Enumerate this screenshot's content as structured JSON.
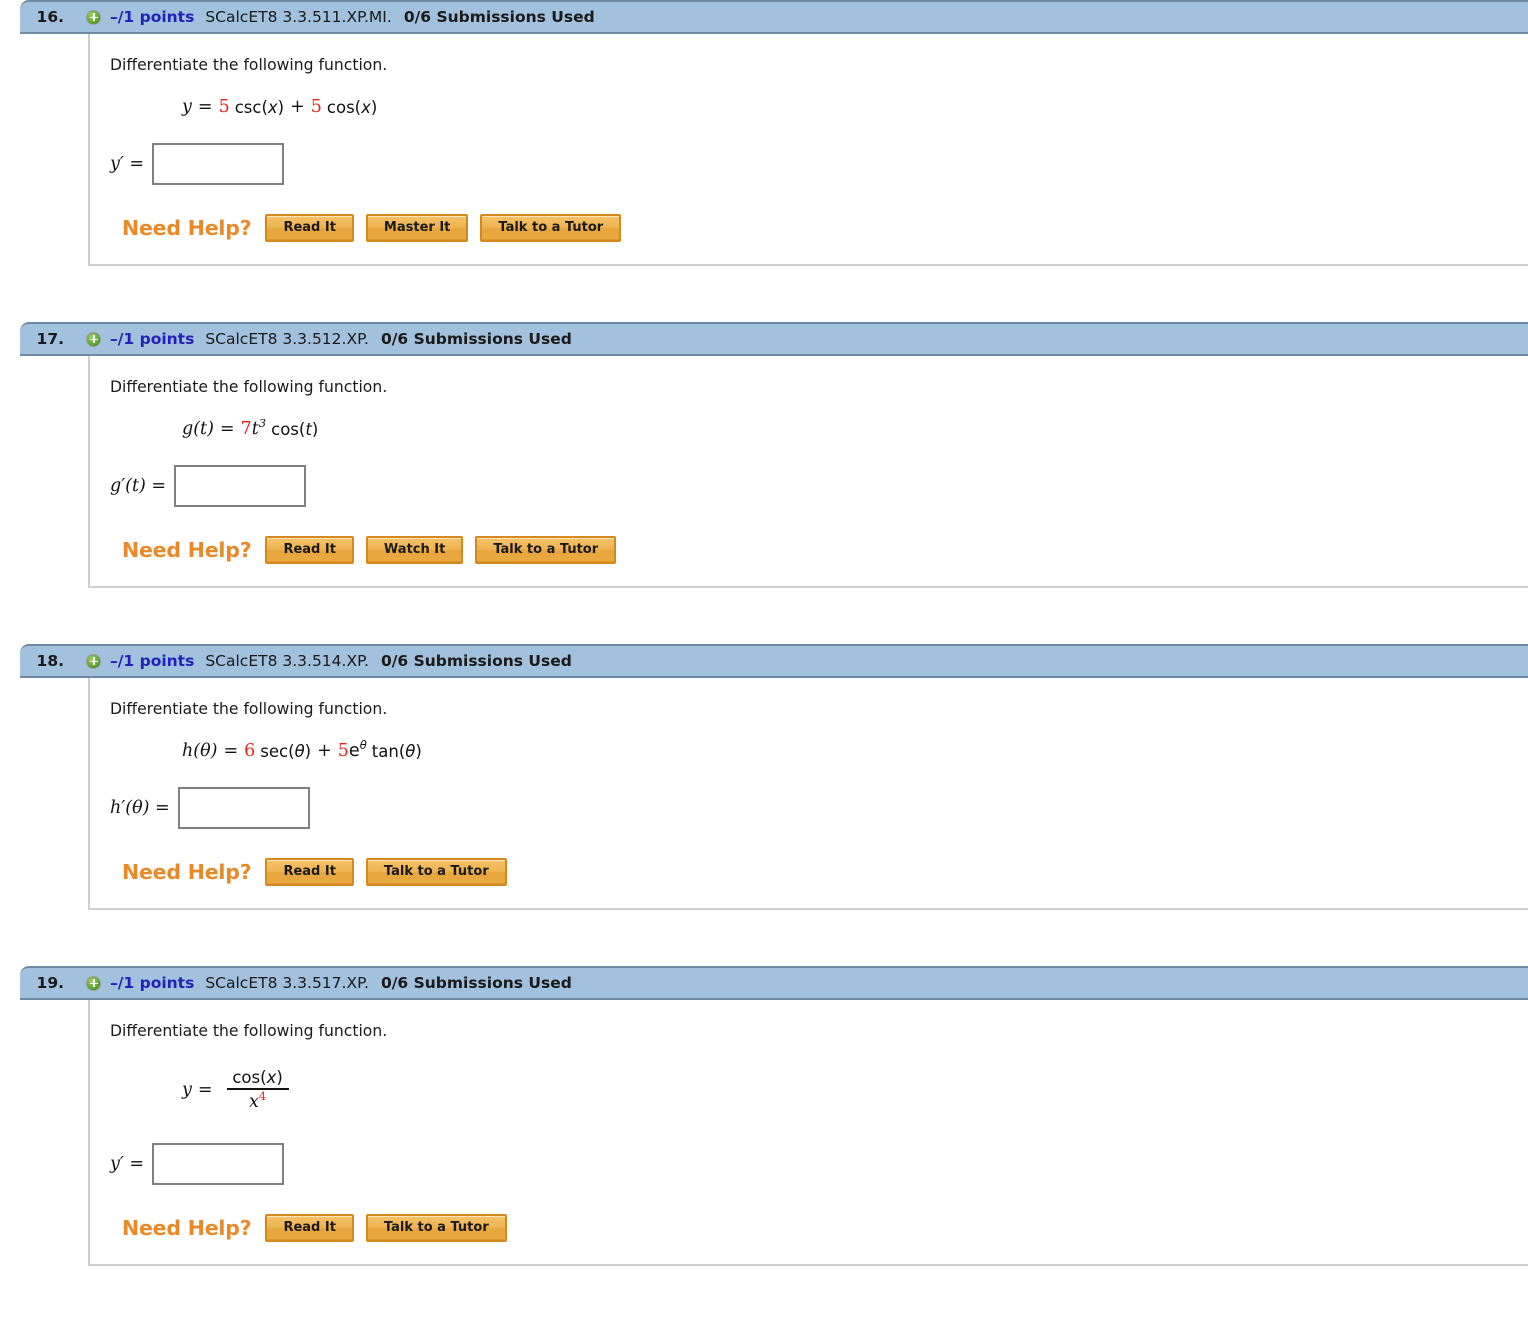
{
  "theme": {
    "header_bg": "#a1c1dc",
    "header_border": "#6f8ba3",
    "points_color": "#2222bb",
    "need_help_color": "#e8892a",
    "math_accent": "#e8241d",
    "button_bg": "#efb453",
    "button_border": "#d4881d",
    "panel_border": "#cfcfcf"
  },
  "labels": {
    "points": "–/1 points",
    "submissions": "0/6 Submissions Used",
    "need_help": "Need Help?",
    "prompt": "Differentiate the following function.",
    "plus_icon": "plus-icon",
    "answer_placeholder": ""
  },
  "questions": [
    {
      "number": "16.",
      "points": "–/1 points",
      "code": "SCalcET8 3.3.511.XP.MI.",
      "submissions": "0/6 Submissions Used",
      "prompt": "Differentiate the following function.",
      "function_display": "y = 5 csc(x) + 5 cos(x)",
      "function_parts": {
        "lhs": "y",
        "equals": "=",
        "coef1": "5",
        "term1": "csc(x)",
        "plus": "+",
        "coef2": "5",
        "term2": "cos(x)",
        "arg1": "x",
        "arg2": "x"
      },
      "answer_label": "y′ =",
      "answer_value": "",
      "help_buttons": [
        "Read It",
        "Master It",
        "Talk to a Tutor"
      ]
    },
    {
      "number": "17.",
      "points": "–/1 points",
      "code": "SCalcET8 3.3.512.XP.",
      "submissions": "0/6 Submissions Used",
      "prompt": "Differentiate the following function.",
      "function_display": "g(t) = 7t^3 cos(t)",
      "function_parts": {
        "lhs_fn": "g",
        "lhs_arg": "t",
        "equals": "=",
        "coef1": "7",
        "base": "t",
        "exponent": "3",
        "term1": "cos(t)",
        "arg1": "t"
      },
      "answer_label": "g′(t) =",
      "answer_value": "",
      "help_buttons": [
        "Read It",
        "Watch It",
        "Talk to a Tutor"
      ]
    },
    {
      "number": "18.",
      "points": "–/1 points",
      "code": "SCalcET8 3.3.514.XP.",
      "submissions": "0/6 Submissions Used",
      "prompt": "Differentiate the following function.",
      "function_display": "h(θ) = 6 sec(θ) + 5e^θ tan(θ)",
      "function_parts": {
        "lhs_fn": "h",
        "lhs_arg": "θ",
        "equals": "=",
        "coef1": "6",
        "term1": "sec(θ)",
        "plus": "+",
        "coef2": "5",
        "base": "e",
        "exponent": "θ",
        "term2": "tan(θ)"
      },
      "answer_label": "h′(θ) =",
      "answer_value": "",
      "help_buttons": [
        "Read It",
        "Talk to a Tutor"
      ]
    },
    {
      "number": "19.",
      "points": "–/1 points",
      "code": "SCalcET8 3.3.517.XP.",
      "submissions": "0/6 Submissions Used",
      "prompt": "Differentiate the following function.",
      "function_display": "y = cos(x) / x^4",
      "function_parts": {
        "lhs": "y",
        "equals": "=",
        "numerator": "cos(x)",
        "denominator_base": "x",
        "denominator_exponent": "4"
      },
      "answer_label": "y′ =",
      "answer_value": "",
      "help_buttons": [
        "Read It",
        "Talk to a Tutor"
      ]
    }
  ]
}
